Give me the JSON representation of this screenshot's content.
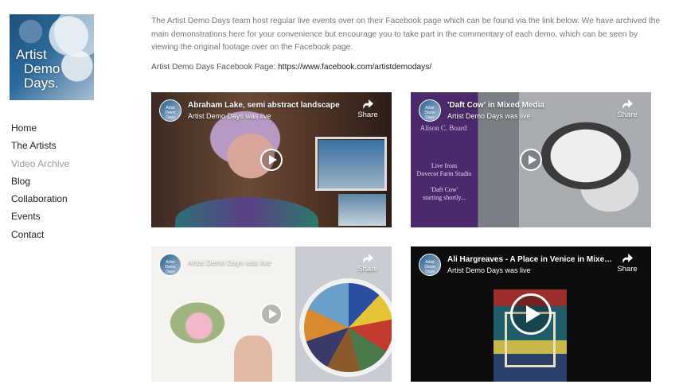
{
  "logo": {
    "line1": "Artist",
    "line2": "Demo",
    "line3": "Days."
  },
  "nav": [
    {
      "label": "Home"
    },
    {
      "label": "The Artists"
    },
    {
      "label": "Video Archive",
      "active": true
    },
    {
      "label": "Blog"
    },
    {
      "label": "Collaboration"
    },
    {
      "label": "Events"
    },
    {
      "label": "Contact"
    }
  ],
  "intro": {
    "text": "The Artist Demo Days team host regular live events over on their Facebook page which can be found via the link below. We have archived the main demonstrations here for your convenience but encourage you to take part in the commentary of each demo, which can be seen by viewing the original footage over on the Facebook page.",
    "fb_label": "Artist Demo Days Facebook Page: ",
    "fb_link": "https://www.facebook.com/artistdemodays/"
  },
  "videos": [
    {
      "title": "Abraham Lake, semi abstract landscape",
      "subtitle": "Artist Demo Days was live",
      "share": "Share",
      "avatar": "Artist Demo Days"
    },
    {
      "title": "'Daft Cow' in Mixed Media",
      "subtitle": "Artist Demo Days was live",
      "share": "Share",
      "avatar": "Artist Demo Days",
      "overlay": {
        "board": "Alison C. Board",
        "live1": "Live from",
        "live2": "Dovecot Farm Studio",
        "daft": "'Daft Cow'",
        "starting": "starting shortly..."
      }
    },
    {
      "title": "",
      "subtitle": "Artist Demo Days was live",
      "share": "Share",
      "avatar": "Artist Demo Days"
    },
    {
      "title": "Ali Hargreaves - A Place in Venice in Mixed ...",
      "subtitle": "Artist Demo Days was live",
      "share": "Share",
      "avatar": "Artist Demo Days"
    }
  ]
}
